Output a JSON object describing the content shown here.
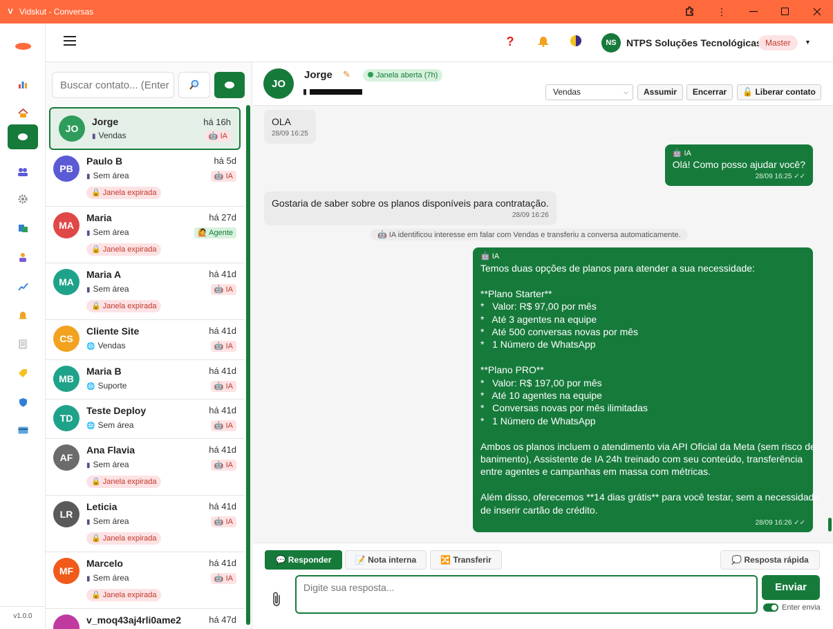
{
  "window": {
    "title": "Vidskut - Conversas",
    "logo": "V"
  },
  "rail": {
    "items": [
      "chart-icon",
      "home-icon",
      "chat-icon",
      "users-icon",
      "settings-icon",
      "campaign-icon",
      "agent-icon",
      "analytics-icon",
      "notification-icon",
      "document-icon",
      "tag-icon",
      "shield-icon",
      "card-icon"
    ],
    "version": "v1.0.0"
  },
  "header": {
    "org_initials": "NS",
    "org_name": "NTPS Soluções Tecnológicas",
    "role": "Master"
  },
  "search": {
    "placeholder": "Buscar contato... (Enter"
  },
  "contacts": [
    {
      "initials": "JO",
      "name": "Jorge",
      "area": "Vendas",
      "area_icon": "phone",
      "time": "há 16h",
      "tag": "IA",
      "expired": "",
      "color": "#2e9d5b",
      "active": true
    },
    {
      "initials": "PB",
      "name": "Paulo B",
      "area": "Sem área",
      "area_icon": "phone",
      "time": "há 5d",
      "tag": "IA",
      "expired": "Janela expirada",
      "color": "#5b5bd6"
    },
    {
      "initials": "MA",
      "name": "Maria",
      "area": "Sem área",
      "area_icon": "phone",
      "time": "há 27d",
      "tag": "Agente",
      "expired": "Janela expirada",
      "color": "#e04848"
    },
    {
      "initials": "MA",
      "name": "Maria A",
      "area": "Sem área",
      "area_icon": "phone",
      "time": "há 41d",
      "tag": "IA",
      "expired": "Janela expirada",
      "color": "#1fa28a"
    },
    {
      "initials": "CS",
      "name": "Cliente Site",
      "area": "Vendas",
      "area_icon": "globe",
      "time": "há 41d",
      "tag": "IA",
      "expired": "",
      "color": "#f2a21f"
    },
    {
      "initials": "MB",
      "name": "Maria B",
      "area": "Suporte",
      "area_icon": "globe",
      "time": "há 41d",
      "tag": "IA",
      "expired": "",
      "color": "#1fa28a"
    },
    {
      "initials": "TD",
      "name": "Teste Deploy",
      "area": "Sem área",
      "area_icon": "globe",
      "time": "há 41d",
      "tag": "IA",
      "expired": "",
      "color": "#1fa28a"
    },
    {
      "initials": "AF",
      "name": "Ana Flavia",
      "area": "Sem área",
      "area_icon": "phone",
      "time": "há 41d",
      "tag": "IA",
      "expired": "Janela expirada",
      "color": "#6b6b6b"
    },
    {
      "initials": "LR",
      "name": "Leticia",
      "area": "Sem área",
      "area_icon": "phone",
      "time": "há 41d",
      "tag": "IA",
      "expired": "Janela expirada",
      "color": "#5a5a5a"
    },
    {
      "initials": "MF",
      "name": "Marcelo",
      "area": "Sem área",
      "area_icon": "phone",
      "time": "há 41d",
      "tag": "IA",
      "expired": "Janela expirada",
      "color": "#f05a1a"
    },
    {
      "initials": "",
      "name": "v_moq43aj4rli0ame2",
      "area": "",
      "area_icon": "",
      "time": "há 47d",
      "tag": "",
      "expired": "",
      "color": "#c03aa0"
    }
  ],
  "chat": {
    "initials": "JO",
    "name": "Jorge",
    "window_status": "Janela aberta (7h)",
    "department": "Vendas",
    "actions": {
      "assume": "Assumir",
      "close": "Encerrar",
      "release": "Liberar contato"
    },
    "messages": {
      "m1": {
        "text": "OLA",
        "time": "28/09 16:25"
      },
      "m2": {
        "who": "IA",
        "text": "Olá! Como posso ajudar você?",
        "time": "28/09 16:25"
      },
      "m3": {
        "text": "Gostaria de saber sobre os planos disponíveis para contratação.",
        "time": "28/09 16:26"
      },
      "sys": "IA identificou interesse em falar com Vendas e transferiu a conversa automaticamente.",
      "m4": {
        "who": "IA",
        "lines": [
          "Temos duas opções de planos para atender a sua necessidade:",
          "",
          "**Plano Starter**",
          "*   Valor: R$ 97,00 por mês",
          "*   Até 3 agentes na equipe",
          "*   Até 500 conversas novas por mês",
          "*   1 Número de WhatsApp",
          "",
          "**Plano PRO**",
          "*   Valor: R$ 197,00 por mês",
          "*   Até 10 agentes na equipe",
          "*   Conversas novas por mês ilimitadas",
          "*   1 Número de WhatsApp",
          "",
          "Ambos os planos incluem o atendimento via API Oficial da Meta (sem risco de",
          "banimento), Assistente de IA 24h treinado com seu conteúdo, transferência",
          "entre agentes e campanhas em massa com métricas.",
          "",
          "Além disso, oferecemos **14 dias grátis** para você testar, sem a necessidade",
          "de inserir cartão de crédito."
        ],
        "time": "28/09 16:26"
      }
    }
  },
  "composer": {
    "tabs": {
      "reply": "Responder",
      "note": "Nota interna",
      "transfer": "Transferir",
      "quick": "Resposta rápida"
    },
    "placeholder": "Digite sua resposta...",
    "send": "Enviar",
    "enter_label": "Enter envia"
  },
  "colors": {
    "brand": "#167a3b",
    "titlebar": "#ff6a3d",
    "tag_bg": "#fde2e4",
    "tag_text": "#c0392b"
  }
}
